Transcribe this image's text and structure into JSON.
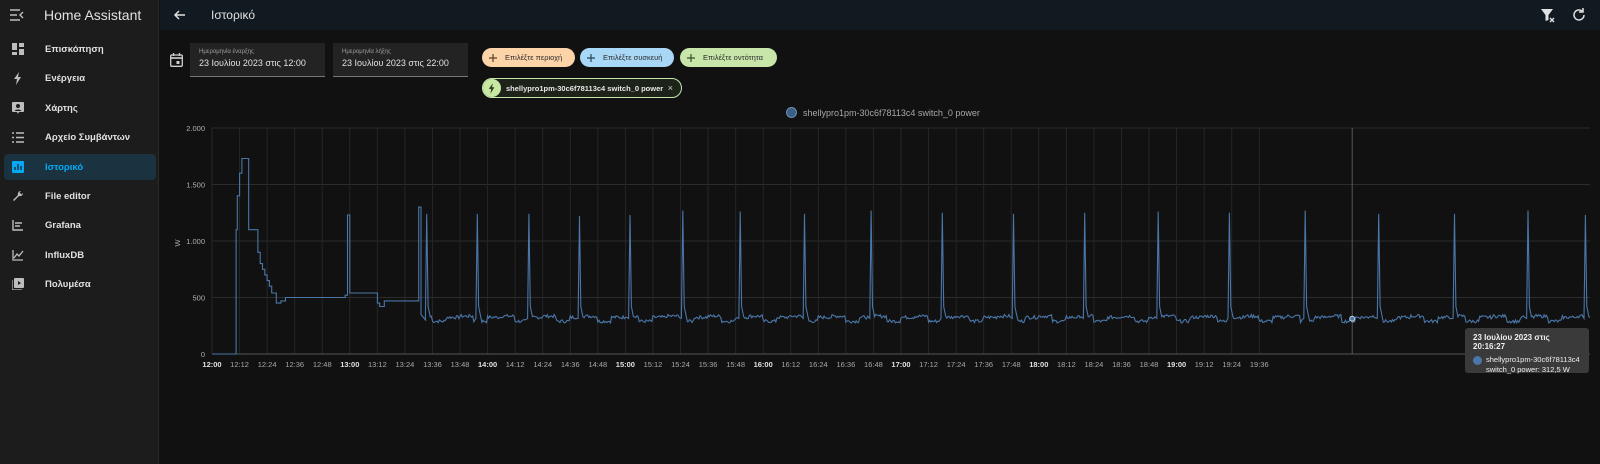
{
  "app": {
    "title": "Home Assistant"
  },
  "sidebar": {
    "items": [
      {
        "label": "Επισκόπηση",
        "icon": "dashboard-icon",
        "active": false
      },
      {
        "label": "Ενέργεια",
        "icon": "lightning-icon",
        "active": false
      },
      {
        "label": "Χάρτης",
        "icon": "map-person-icon",
        "active": false
      },
      {
        "label": "Αρχείο Συμβάντων",
        "icon": "logbook-icon",
        "active": false
      },
      {
        "label": "Ιστορικό",
        "icon": "history-chart-icon",
        "active": true
      },
      {
        "label": "File editor",
        "icon": "wrench-icon",
        "active": false
      },
      {
        "label": "Grafana",
        "icon": "grafana-icon",
        "active": false
      },
      {
        "label": "InfluxDB",
        "icon": "influxdb-chart-icon",
        "active": false
      },
      {
        "label": "Πολυμέσα",
        "icon": "media-play-icon",
        "active": false
      }
    ]
  },
  "header": {
    "title": "Ιστορικό"
  },
  "dates": {
    "start_label": "Ημερομηνία έναρξης",
    "start_value": "23 Ιουλίου 2023 στις 12:00",
    "end_label": "Ημερομηνία λήξης",
    "end_value": "23 Ιουλίου 2023 στις 22:00"
  },
  "chips": {
    "area": "Επιλέξτε περιοχή",
    "device": "Επιλέξτε συσκευή",
    "entity": "Επιλέξτε οντότητα",
    "selected_entity": "shellypro1pm-30c6f78113c4 switch_0 power",
    "close_symbol": "×"
  },
  "colors": {
    "accent": "#03a9f4",
    "area_chip": "#fdd3a8",
    "device_chip": "#a9d7f6",
    "entity_chip": "#c8e6a9",
    "series": "#4a76a8"
  },
  "chart_data": {
    "type": "line",
    "legend": "shellypro1pm-30c6f78113c4 switch_0 power",
    "legend_position": "top-center",
    "ylabel": "W",
    "xlabel": "",
    "ylim": [
      0,
      2000
    ],
    "yticks": [
      {
        "v": 0,
        "label": "0"
      },
      {
        "v": 500,
        "label": "500"
      },
      {
        "v": 1000,
        "label": "1.000"
      },
      {
        "v": 1500,
        "label": "1.500"
      },
      {
        "v": 2000,
        "label": "2.000"
      }
    ],
    "xlim": [
      "12:00",
      "22:00"
    ],
    "xticks": [
      "12:00",
      "12:12",
      "12:24",
      "12:36",
      "12:48",
      "13:00",
      "13:12",
      "13:24",
      "13:36",
      "13:48",
      "14:00",
      "14:12",
      "14:24",
      "14:36",
      "14:48",
      "15:00",
      "15:12",
      "15:24",
      "15:36",
      "15:48",
      "16:00",
      "16:12",
      "16:24",
      "16:36",
      "16:48",
      "17:00",
      "17:12",
      "17:24",
      "17:36",
      "17:48",
      "18:00",
      "18:12",
      "18:24",
      "18:36",
      "18:48",
      "19:00",
      "19:12",
      "19:24",
      "19:36"
    ],
    "bold_ticks": [
      "12:00",
      "13:00",
      "14:00",
      "15:00",
      "16:00",
      "17:00",
      "18:00",
      "19:00"
    ],
    "grid": true,
    "series": [
      {
        "name": "shellypro1pm-30c6f78113c4 switch_0 power",
        "step": true,
        "base_level": 315,
        "points": [
          [
            0,
            0
          ],
          [
            10,
            0
          ],
          [
            10.5,
            1100
          ],
          [
            11,
            1400
          ],
          [
            12,
            1600
          ],
          [
            13,
            1730
          ],
          [
            15,
            1730
          ],
          [
            16,
            1100
          ],
          [
            19,
            1100
          ],
          [
            20,
            900
          ],
          [
            21,
            800
          ],
          [
            22,
            750
          ],
          [
            23,
            700
          ],
          [
            24,
            650
          ],
          [
            25,
            600
          ],
          [
            26,
            540
          ],
          [
            28,
            450
          ],
          [
            30,
            470
          ],
          [
            32,
            500
          ],
          [
            55,
            500
          ],
          [
            58,
            520
          ],
          [
            59,
            1230
          ],
          [
            60,
            540
          ],
          [
            70,
            540
          ],
          [
            72,
            450
          ],
          [
            73,
            420
          ],
          [
            75,
            470
          ],
          [
            89,
            470
          ],
          [
            90,
            1300
          ],
          [
            91,
            350
          ],
          [
            93,
            300
          ]
        ],
        "spikes_min": [
          93.5,
          115.5,
          138,
          160,
          182,
          205,
          230,
          258,
          287,
          318,
          349,
          380,
          412,
          443,
          476,
          508,
          541,
          573,
          598
        ],
        "spike_peaks": [
          1240,
          1240,
          1240,
          1220,
          1230,
          1270,
          1260,
          1240,
          1270,
          1250,
          1240,
          1250,
          1260,
          1250,
          1270,
          1240,
          1240,
          1270,
          1230
        ]
      }
    ]
  },
  "tooltip": {
    "title": "23 Ιουλίου 2023 στις 20:16:27",
    "line1": "shellypro1pm-30c6f78113c4",
    "line2": "switch_0 power: 312,5 W"
  }
}
